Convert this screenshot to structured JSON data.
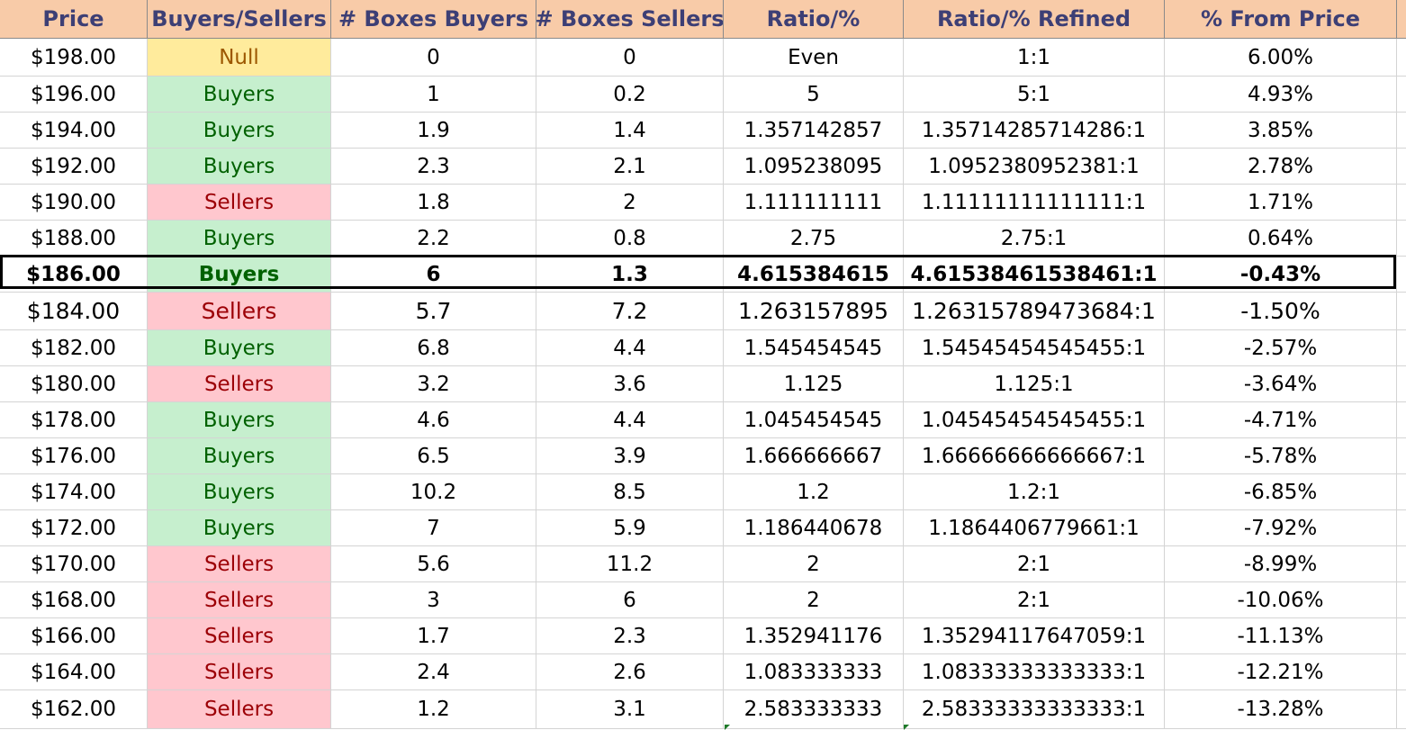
{
  "colors": {
    "header_bg": "#f8cba8",
    "header_fg": "#3d3f75",
    "buyers_bg": "#c6efce",
    "buyers_fg": "#006100",
    "sellers_bg": "#ffc7ce",
    "sellers_fg": "#9c0006",
    "null_bg": "#ffeb9c",
    "null_fg": "#9c5700"
  },
  "headers": [
    "Price",
    "Buyers/Sellers",
    "# Boxes Buyers",
    "# Boxes Sellers",
    "Ratio/%",
    "Ratio/% Refined",
    "% From Price"
  ],
  "current_price_row": "$186.00",
  "rows": [
    {
      "price": "$198.00",
      "side": "Null",
      "buyers": "0",
      "sellers": "0",
      "ratio": "Even",
      "refined": "1:1",
      "from_price": "6.00%"
    },
    {
      "price": "$196.00",
      "side": "Buyers",
      "buyers": "1",
      "sellers": "0.2",
      "ratio": "5",
      "refined": "5:1",
      "from_price": "4.93%"
    },
    {
      "price": "$194.00",
      "side": "Buyers",
      "buyers": "1.9",
      "sellers": "1.4",
      "ratio": "1.357142857",
      "refined": "1.35714285714286:1",
      "from_price": "3.85%"
    },
    {
      "price": "$192.00",
      "side": "Buyers",
      "buyers": "2.3",
      "sellers": "2.1",
      "ratio": "1.095238095",
      "refined": "1.0952380952381:1",
      "from_price": "2.78%"
    },
    {
      "price": "$190.00",
      "side": "Sellers",
      "buyers": "1.8",
      "sellers": "2",
      "ratio": "1.111111111",
      "refined": "1.11111111111111:1",
      "from_price": "1.71%"
    },
    {
      "price": "$188.00",
      "side": "Buyers",
      "buyers": "2.2",
      "sellers": "0.8",
      "ratio": "2.75",
      "refined": "2.75:1",
      "from_price": "0.64%"
    },
    {
      "price": "$186.00",
      "side": "Buyers",
      "buyers": "6",
      "sellers": "1.3",
      "ratio": "4.615384615",
      "refined": "4.61538461538461:1",
      "from_price": "-0.43%"
    },
    {
      "price": "$184.00",
      "side": "Sellers",
      "buyers": "5.7",
      "sellers": "7.2",
      "ratio": "1.263157895",
      "refined": "1.26315789473684:1",
      "from_price": "-1.50%"
    },
    {
      "price": "$182.00",
      "side": "Buyers",
      "buyers": "6.8",
      "sellers": "4.4",
      "ratio": "1.545454545",
      "refined": "1.54545454545455:1",
      "from_price": "-2.57%"
    },
    {
      "price": "$180.00",
      "side": "Sellers",
      "buyers": "3.2",
      "sellers": "3.6",
      "ratio": "1.125",
      "refined": "1.125:1",
      "from_price": "-3.64%"
    },
    {
      "price": "$178.00",
      "side": "Buyers",
      "buyers": "4.6",
      "sellers": "4.4",
      "ratio": "1.045454545",
      "refined": "1.04545454545455:1",
      "from_price": "-4.71%"
    },
    {
      "price": "$176.00",
      "side": "Buyers",
      "buyers": "6.5",
      "sellers": "3.9",
      "ratio": "1.666666667",
      "refined": "1.66666666666667:1",
      "from_price": "-5.78%"
    },
    {
      "price": "$174.00",
      "side": "Buyers",
      "buyers": "10.2",
      "sellers": "8.5",
      "ratio": "1.2",
      "refined": "1.2:1",
      "from_price": "-6.85%"
    },
    {
      "price": "$172.00",
      "side": "Buyers",
      "buyers": "7",
      "sellers": "5.9",
      "ratio": "1.186440678",
      "refined": "1.1864406779661:1",
      "from_price": "-7.92%"
    },
    {
      "price": "$170.00",
      "side": "Sellers",
      "buyers": "5.6",
      "sellers": "11.2",
      "ratio": "2",
      "refined": "2:1",
      "from_price": "-8.99%"
    },
    {
      "price": "$168.00",
      "side": "Sellers",
      "buyers": "3",
      "sellers": "6",
      "ratio": "2",
      "refined": "2:1",
      "from_price": "-10.06%"
    },
    {
      "price": "$166.00",
      "side": "Sellers",
      "buyers": "1.7",
      "sellers": "2.3",
      "ratio": "1.352941176",
      "refined": "1.35294117647059:1",
      "from_price": "-11.13%"
    },
    {
      "price": "$164.00",
      "side": "Sellers",
      "buyers": "2.4",
      "sellers": "2.6",
      "ratio": "1.083333333",
      "refined": "1.08333333333333:1",
      "from_price": "-12.21%"
    },
    {
      "price": "$162.00",
      "side": "Sellers",
      "buyers": "1.2",
      "sellers": "3.1",
      "ratio": "2.583333333",
      "refined": "2.58333333333333:1",
      "from_price": "-13.28%"
    }
  ]
}
